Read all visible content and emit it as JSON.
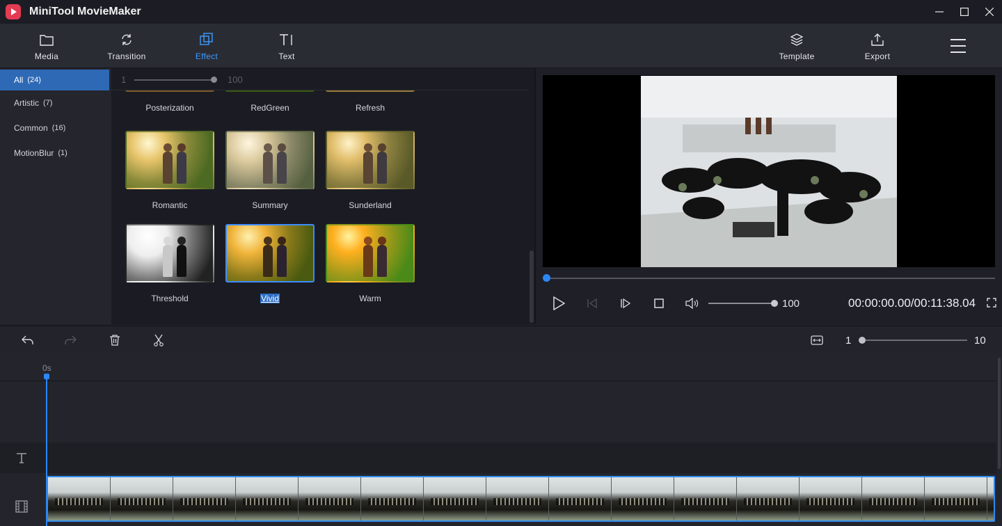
{
  "app": {
    "title": "MiniTool MovieMaker"
  },
  "window_controls": {
    "minimize": "—",
    "maximize": "☐",
    "close": "✕"
  },
  "toolbar": {
    "media": "Media",
    "transition": "Transition",
    "effect": "Effect",
    "text": "Text",
    "template": "Template",
    "export": "Export"
  },
  "categories": [
    {
      "label": "All",
      "count": "(24)"
    },
    {
      "label": "Artistic",
      "count": "(7)"
    },
    {
      "label": "Common",
      "count": "(16)"
    },
    {
      "label": "MotionBlur",
      "count": "(1)"
    }
  ],
  "effect_slider": {
    "min": "1",
    "max": "100"
  },
  "effects": [
    {
      "name": "Posterization"
    },
    {
      "name": "RedGreen"
    },
    {
      "name": "Refresh"
    },
    {
      "name": "Romantic"
    },
    {
      "name": "Summary"
    },
    {
      "name": "Sunderland"
    },
    {
      "name": "Threshold"
    },
    {
      "name": "Vivid"
    },
    {
      "name": "Warm"
    }
  ],
  "player": {
    "volume": "100",
    "timecode": "00:00:00.00/00:11:38.04"
  },
  "timeline": {
    "ruler_zero": "0s",
    "zoom_min": "1",
    "zoom_max": "10"
  },
  "colors": {
    "accent": "#2b87f5",
    "selected_category": "#2e69b5",
    "background": "#1f2027"
  }
}
